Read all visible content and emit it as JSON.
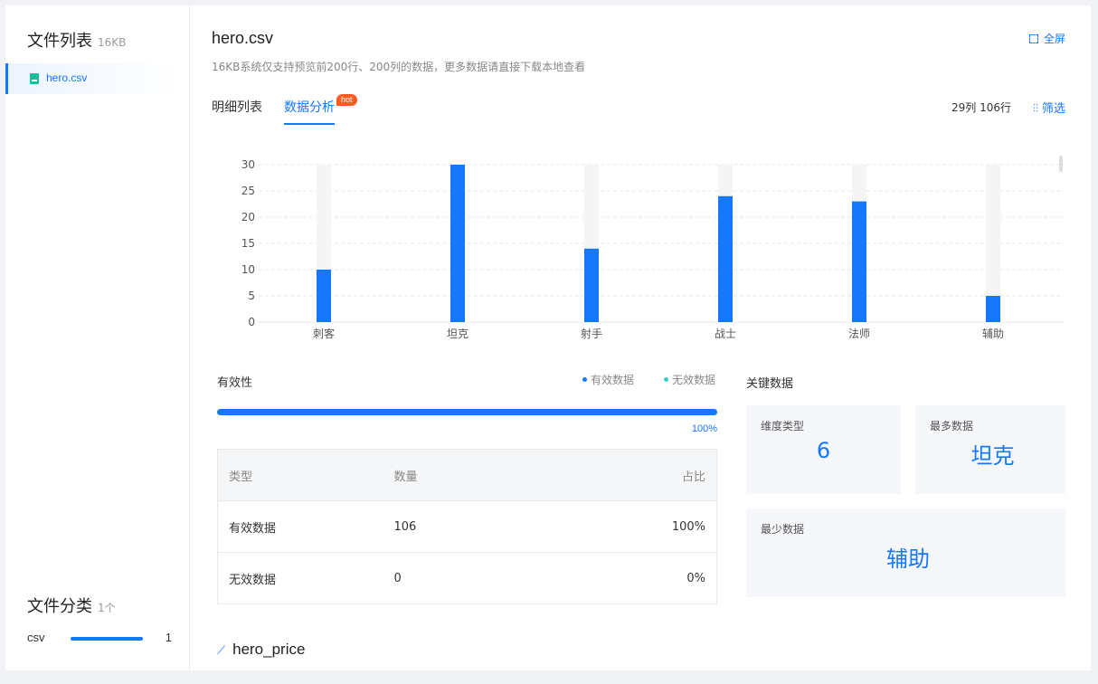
{
  "sidebar": {
    "title": "文件列表",
    "size": "16KB",
    "files": [
      {
        "name": "hero.csv"
      }
    ],
    "category_title": "文件分类",
    "category_count": "1个",
    "categories": [
      {
        "name": "csv",
        "count": "1"
      }
    ]
  },
  "main": {
    "file_title": "hero.csv",
    "fullscreen_label": "全屏",
    "description": "16KB系统仅支持预览前200行、200列的数据，更多数据请直接下载本地查看",
    "tabs": [
      {
        "label": "明细列表"
      },
      {
        "label": "数据分析"
      }
    ],
    "hot_badge": "hot",
    "dimensions": "29列 106行",
    "filter_label": "筛选"
  },
  "chart_data": {
    "type": "bar",
    "categories": [
      "刺客",
      "坦克",
      "射手",
      "战士",
      "法师",
      "辅助"
    ],
    "values": [
      10,
      30,
      14,
      24,
      23,
      5
    ],
    "ylim": [
      0,
      30
    ],
    "yticks": [
      0,
      5,
      10,
      15,
      20,
      25,
      30
    ],
    "grid": true,
    "bar_color": "#1677ff",
    "track_color": "#f5f5f5"
  },
  "validity": {
    "title": "有效性",
    "legend": [
      {
        "label": "有效数据",
        "color": "#1677ff"
      },
      {
        "label": "无效数据",
        "color": "#36cbcb"
      }
    ],
    "progress": 1.0,
    "percent_label": "100%",
    "table": {
      "headers": [
        "类型",
        "数量",
        "占比"
      ],
      "rows": [
        [
          "有效数据",
          "106",
          "100%"
        ],
        [
          "无效数据",
          "0",
          "0%"
        ]
      ]
    }
  },
  "key_data": {
    "title": "关键数据",
    "cards": [
      {
        "label": "维度类型",
        "value": "6"
      },
      {
        "label": "最多数据",
        "value": "坦克"
      },
      {
        "label": "最少数据",
        "value": "辅助"
      }
    ]
  },
  "next_section": {
    "title": "hero_price",
    "icon": "line-chart-icon"
  }
}
